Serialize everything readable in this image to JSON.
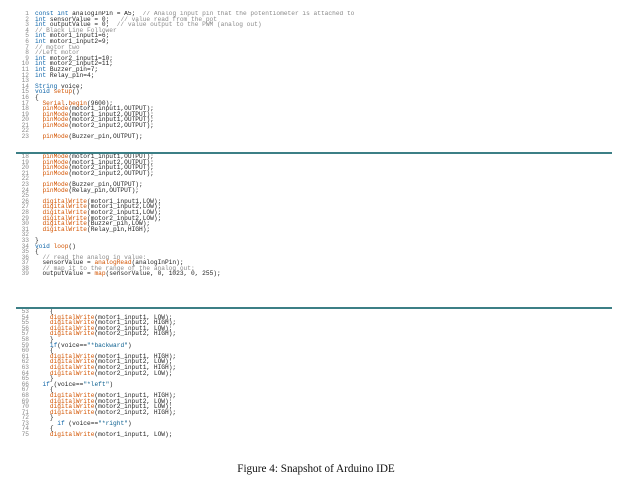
{
  "caption": "Figure 4: Snapshot of Arduino IDE",
  "colors": {
    "keyword": "#0d64a8",
    "function": "#d35400",
    "comment": "#8a8a8a",
    "divider": "#3c7f86"
  },
  "top_panel": {
    "lines": [
      {
        "n": "1",
        "t": "const int analogInPin = A5;  // Analog input pin that the potentiometer is attached to"
      },
      {
        "n": "2",
        "t": "int sensorValue = 0;   // value read from the pot"
      },
      {
        "n": "3",
        "t": "int outputValue = 0;  // value output to the PWM (analog out)"
      },
      {
        "n": "4",
        "t": "// Black Line Follower"
      },
      {
        "n": "5",
        "t": "int motor1_input1=6;"
      },
      {
        "n": "6",
        "t": "int motor1_input2=9;"
      },
      {
        "n": "7",
        "t": "// motor two"
      },
      {
        "n": "8",
        "t": "//Left motor"
      },
      {
        "n": "9",
        "t": "int motor2_input1=10;"
      },
      {
        "n": "10",
        "t": "int motor2_input2=11;"
      },
      {
        "n": "11",
        "t": "int Buzzer_pin=7;"
      },
      {
        "n": "12",
        "t": "int Relay_pin=4;"
      },
      {
        "n": "13",
        "t": ""
      },
      {
        "n": "14",
        "t": "String voice;"
      },
      {
        "n": "15",
        "t": "void setup()"
      },
      {
        "n": "16",
        "t": "{"
      },
      {
        "n": "17",
        "t": "  Serial.begin(9600);"
      },
      {
        "n": "18",
        "t": "  pinMode(motor1_input1,OUTPUT);"
      },
      {
        "n": "19",
        "t": "  pinMode(motor1_input2,OUTPUT);"
      },
      {
        "n": "20",
        "t": "  pinMode(motor2_input1,OUTPUT);"
      },
      {
        "n": "21",
        "t": "  pinMode(motor2_input2,OUTPUT);"
      },
      {
        "n": "22",
        "t": ""
      },
      {
        "n": "23",
        "t": "  pinMode(Buzzer_pin,OUTPUT);"
      }
    ]
  },
  "mid_panel": {
    "lines": [
      {
        "n": "18",
        "t": "  pinMode(motor1_input1,OUTPUT);"
      },
      {
        "n": "19",
        "t": "  pinMode(motor1_input2,OUTPUT);"
      },
      {
        "n": "20",
        "t": "  pinMode(motor2_input1,OUTPUT);"
      },
      {
        "n": "21",
        "t": "  pinMode(motor2_input2,OUTPUT);"
      },
      {
        "n": "22",
        "t": ""
      },
      {
        "n": "23",
        "t": "  pinMode(Buzzer_pin,OUTPUT);"
      },
      {
        "n": "24",
        "t": "  pinMode(Relay_pin,OUTPUT);"
      },
      {
        "n": "25",
        "t": ""
      },
      {
        "n": "26",
        "t": "  digitalWrite(motor1_input1,LOW);"
      },
      {
        "n": "27",
        "t": "  digitalWrite(motor1_input2,LOW);"
      },
      {
        "n": "28",
        "t": "  digitalWrite(motor2_input1,LOW);"
      },
      {
        "n": "29",
        "t": "  digitalWrite(motor2_input2,LOW);"
      },
      {
        "n": "30",
        "t": "  digitalWrite(Buzzer_pin,LOW);"
      },
      {
        "n": "31",
        "t": "  digitalWrite(Relay_pin,HIGH);"
      },
      {
        "n": "32",
        "t": ""
      },
      {
        "n": "33",
        "t": "}"
      },
      {
        "n": "34",
        "t": "void loop()"
      },
      {
        "n": "35",
        "t": "{"
      },
      {
        "n": "36",
        "t": "  // read the analog in value:"
      },
      {
        "n": "37",
        "t": "  sensorValue = analogRead(analogInPin);"
      },
      {
        "n": "38",
        "t": "  // map it to the range of the analog out:"
      },
      {
        "n": "39",
        "t": "  outputValue = map(sensorValue, 0, 1023, 0, 255);"
      }
    ]
  },
  "bot_panel": {
    "lines": [
      {
        "n": "53",
        "t": "    {"
      },
      {
        "n": "54",
        "t": "    digitalWrite(motor1_input1, LOW);"
      },
      {
        "n": "55",
        "t": "    digitalWrite(motor1_input2, HIGH);"
      },
      {
        "n": "56",
        "t": "    digitalWrite(motor2_input1, LOW);"
      },
      {
        "n": "57",
        "t": "    digitalWrite(motor2_input2, HIGH);"
      },
      {
        "n": "58",
        "t": "    }"
      },
      {
        "n": "59",
        "t": "    if(voice==\"*backward\")"
      },
      {
        "n": "60",
        "t": "    {"
      },
      {
        "n": "61",
        "t": "    digitalWrite(motor1_input1, HIGH);"
      },
      {
        "n": "62",
        "t": "    digitalWrite(motor1_input2, LOW);"
      },
      {
        "n": "63",
        "t": "    digitalWrite(motor2_input1, HIGH);"
      },
      {
        "n": "64",
        "t": "    digitalWrite(motor2_input2, LOW);"
      },
      {
        "n": "65",
        "t": "    }"
      },
      {
        "n": "66",
        "t": "  if (voice==\"*left\")"
      },
      {
        "n": "67",
        "t": "    {"
      },
      {
        "n": "68",
        "t": "    digitalWrite(motor1_input1, HIGH);"
      },
      {
        "n": "69",
        "t": "    digitalWrite(motor1_input2, LOW);"
      },
      {
        "n": "70",
        "t": "    digitalWrite(motor2_input1, LOW);"
      },
      {
        "n": "71",
        "t": "    digitalWrite(motor2_input2, HIGH);"
      },
      {
        "n": "72",
        "t": "    }"
      },
      {
        "n": "73",
        "t": "      if (voice==\"*right\")"
      },
      {
        "n": "74",
        "t": "    {"
      },
      {
        "n": "75",
        "t": "    digitalWrite(motor1_input1, LOW);"
      }
    ]
  }
}
